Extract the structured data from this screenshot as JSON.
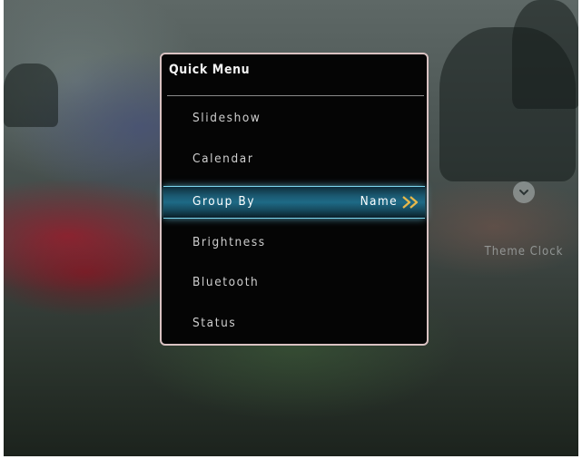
{
  "background": {
    "overlay_label": "Theme Clock",
    "overlay_icon": "chevron-down-icon"
  },
  "menu": {
    "title": "Quick Menu",
    "items": [
      {
        "label": "Slideshow"
      },
      {
        "label": "Calendar"
      },
      {
        "label": "Group By",
        "value": "Name",
        "selected": true
      },
      {
        "label": "Brightness"
      },
      {
        "label": "Bluetooth"
      },
      {
        "label": "Status"
      }
    ]
  },
  "colors": {
    "highlight": "#1e6a86",
    "highlight_edge": "#7ed8f0",
    "arrow": "#e8b84a",
    "menu_background": "#050505"
  }
}
